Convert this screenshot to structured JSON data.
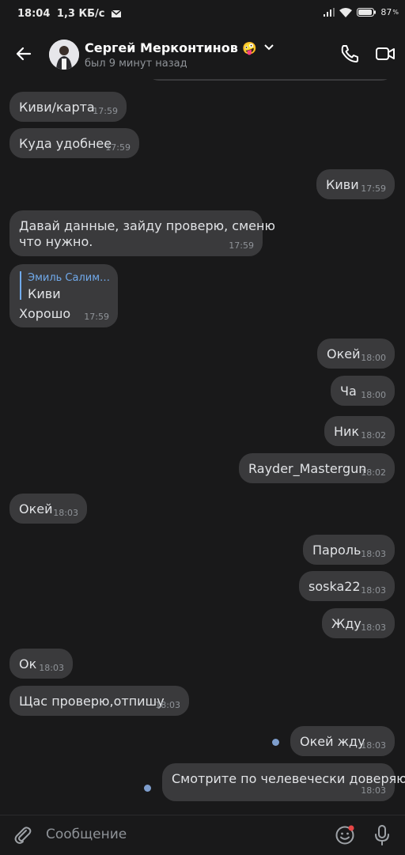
{
  "status_bar": {
    "time": "18:04",
    "speed": "1,3 КБ/с",
    "battery": "87"
  },
  "header": {
    "name": "Сергей Мерконтинов",
    "emoji": "🤪",
    "status": "был 9 минут назад"
  },
  "messages": [
    {
      "side": "in",
      "text": "Киви/карта",
      "time": "17:59"
    },
    {
      "side": "in",
      "text": "Куда удобнее",
      "time": "17:59"
    },
    {
      "side": "out",
      "text": "Киви",
      "time": "17:59"
    },
    {
      "side": "in",
      "lines": [
        "Давай данные, зайду проверю, сменю",
        "что нужно."
      ],
      "time": "17:59"
    },
    {
      "side": "in",
      "reply_author": "Эмиль Салим…",
      "reply_text": "Киви",
      "text": "Хорошо",
      "time": "17:59"
    },
    {
      "side": "out",
      "text": "Окей",
      "time": "18:00"
    },
    {
      "side": "out",
      "text": "Ча",
      "time": "18:00"
    },
    {
      "side": "out",
      "text": "Ник",
      "time": "18:02"
    },
    {
      "side": "out",
      "text": "Rayder_Mastergun",
      "time": "18:02"
    },
    {
      "side": "in",
      "text": "Окей",
      "time": "18:03"
    },
    {
      "side": "out",
      "text": "Пароль",
      "time": "18:03"
    },
    {
      "side": "out",
      "text": "soska22",
      "time": "18:03"
    },
    {
      "side": "out",
      "text": "Жду",
      "time": "18:03"
    },
    {
      "side": "in",
      "text": "Ок",
      "time": "18:03"
    },
    {
      "side": "in",
      "text": "Щас проверю,отпишу",
      "time": "18:03"
    },
    {
      "side": "out",
      "text": "Окей жду",
      "time": "18:03",
      "unread": true
    },
    {
      "side": "out",
      "text": "Смотрите по челевечески доверяю",
      "time": "18:03",
      "unread": true
    }
  ],
  "composer": {
    "placeholder": "Сообщение"
  },
  "icons": {
    "back": "arrow-left-icon",
    "call": "phone-icon",
    "video": "video-camera-icon",
    "attach": "paperclip-icon",
    "emoji": "smile-icon",
    "voice": "microphone-icon"
  }
}
